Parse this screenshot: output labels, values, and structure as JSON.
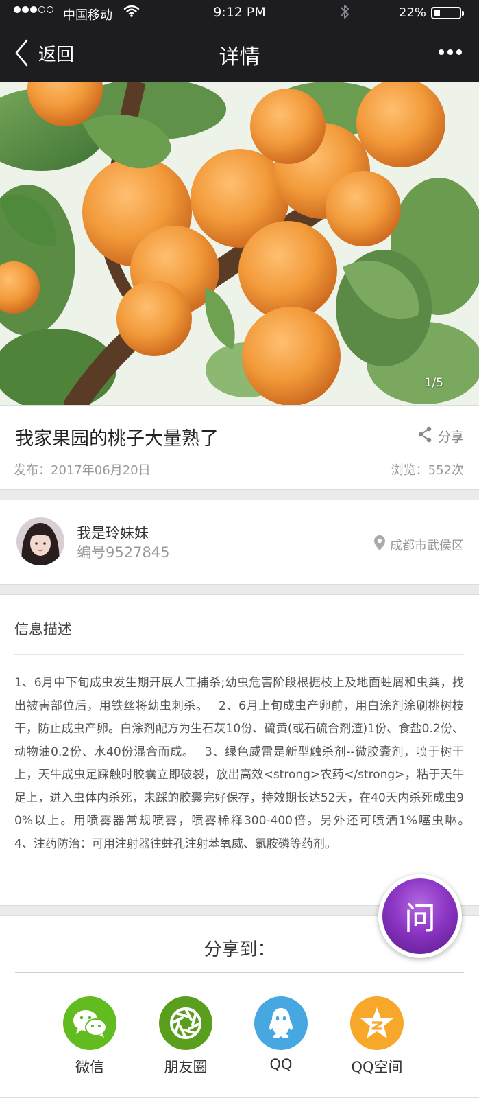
{
  "status_bar": {
    "carrier": "中国移动",
    "time": "9:12 PM",
    "battery": "22%",
    "battery_level": 0.22
  },
  "nav": {
    "back_label": "返回",
    "title": "详情",
    "more_icon": "more-dots-icon"
  },
  "gallery": {
    "counter": "1/5",
    "image": "apricots-on-branch"
  },
  "post": {
    "title": "我家果园的桃子大量熟了",
    "share_label": "分享",
    "published": "发布：2017年06月20日",
    "views": "浏览：552次"
  },
  "author": {
    "name": "我是玲妹妹",
    "id": "编号9527845",
    "location": "成都市武侯区"
  },
  "description": {
    "title": "信息描述",
    "body": "1、6月中下旬成虫发生期开展人工捕杀;幼虫危害阶段根据枝上及地面蛀屑和虫粪，找出被害部位后，用铁丝将幼虫刺杀。　 2、6月上旬成虫产卵前，用白涂剂涂刷桃树枝干，防止成虫产卵。白涂剂配方为生石灰10份、硫黄(或石硫合剂渣)1份、食盐0.2份、动物油0.2份、水40份混合而成。　 3、绿色威雷是新型触杀剂--微胶囊剂，喷于树干上，天牛成虫足踩触时胶囊立即破裂，放出高效<strong>农药</strong>，粘于天牛足上，进入虫体内杀死，未踩的胶囊完好保存，持效期长达52天，在40天内杀死成虫90%以上。用喷雾器常规喷雾，喷雾稀释300-400倍。另外还可喷洒1%噻虫啉。　　 4、注药防治：可用注射器往蛀孔注射苯氧威、氯胺磷等药剂。"
  },
  "share": {
    "heading": "分享到：",
    "targets": [
      {
        "label": "微信",
        "icon": "wechat-icon",
        "color": "#62bb1f"
      },
      {
        "label": "朋友圈",
        "icon": "moments-icon",
        "color": "#5a9e1d"
      },
      {
        "label": "QQ",
        "icon": "qq-icon",
        "color": "#47a7e0"
      },
      {
        "label": "QQ空间",
        "icon": "qzone-icon",
        "color": "#f7a72a"
      }
    ]
  },
  "ask_button": {
    "label": "问",
    "color": "#8b35c4"
  }
}
